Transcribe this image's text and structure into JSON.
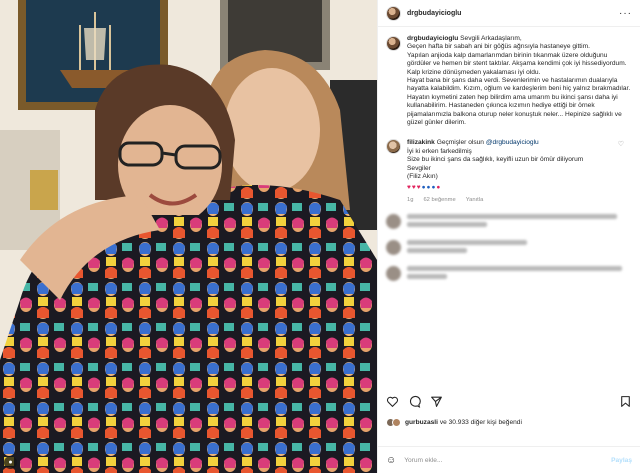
{
  "post": {
    "username": "drgbudayicioglu",
    "caption_user": "drgbudayicioglu",
    "caption_lines": [
      "Sevgili Arkadaşlarım,",
      "Geçen hafta bir sabah ani bir göğüs ağrısıyla hastaneye gittim.",
      "Yapılan anjioda kalp damarlarımdan birinin tıkanmak üzere olduğunu gördüler ve hemen bir stent taktılar. Akşama kendimi çok iyi hissediyordum. Kalp krizine dönüşmeden yakalaması iyi oldu.",
      "Hayat bana bir şans daha verdi. Sevenlerimin ve hastalarımın dualarıyla hayatta kalabildim. Kızım, oğlum ve kardeşlerim beni hiç yalnız bırakmadılar.",
      "Hayatın kıymetini zaten hep bilirdim ama umarım bu ikinci şansı daha iyi kullanabilirim. Hastaneden çıkınca kızımın hediye ettiği bir örnek pijamalarımızla balkona oturup neler konuştuk neler... Hepinize sağlıklı ve güzel günler dilerim."
    ],
    "comment": {
      "user": "filizakink",
      "mention": "@drgbudayicioglu",
      "intro": "Geçmişler olsun",
      "lines": [
        "İyi ki erken farkedilmiş",
        "Size bu ikinci şans da sağlıklı, keyifli uzun bir ömür diliyorum",
        "Sevgiler",
        "(Filiz Akın)"
      ],
      "emojis": [
        "♥",
        "♥",
        "♥",
        "●",
        "●",
        "●",
        "●"
      ],
      "time": "1g",
      "likes": "62 beğenme",
      "reply": "Yanıtla"
    },
    "likes_by": "gurbuzasli",
    "likes_rest": " ve 30.933 diğer kişi beğendi",
    "comment_placeholder": "Yorum ekle...",
    "post_button": "Paylaş"
  }
}
